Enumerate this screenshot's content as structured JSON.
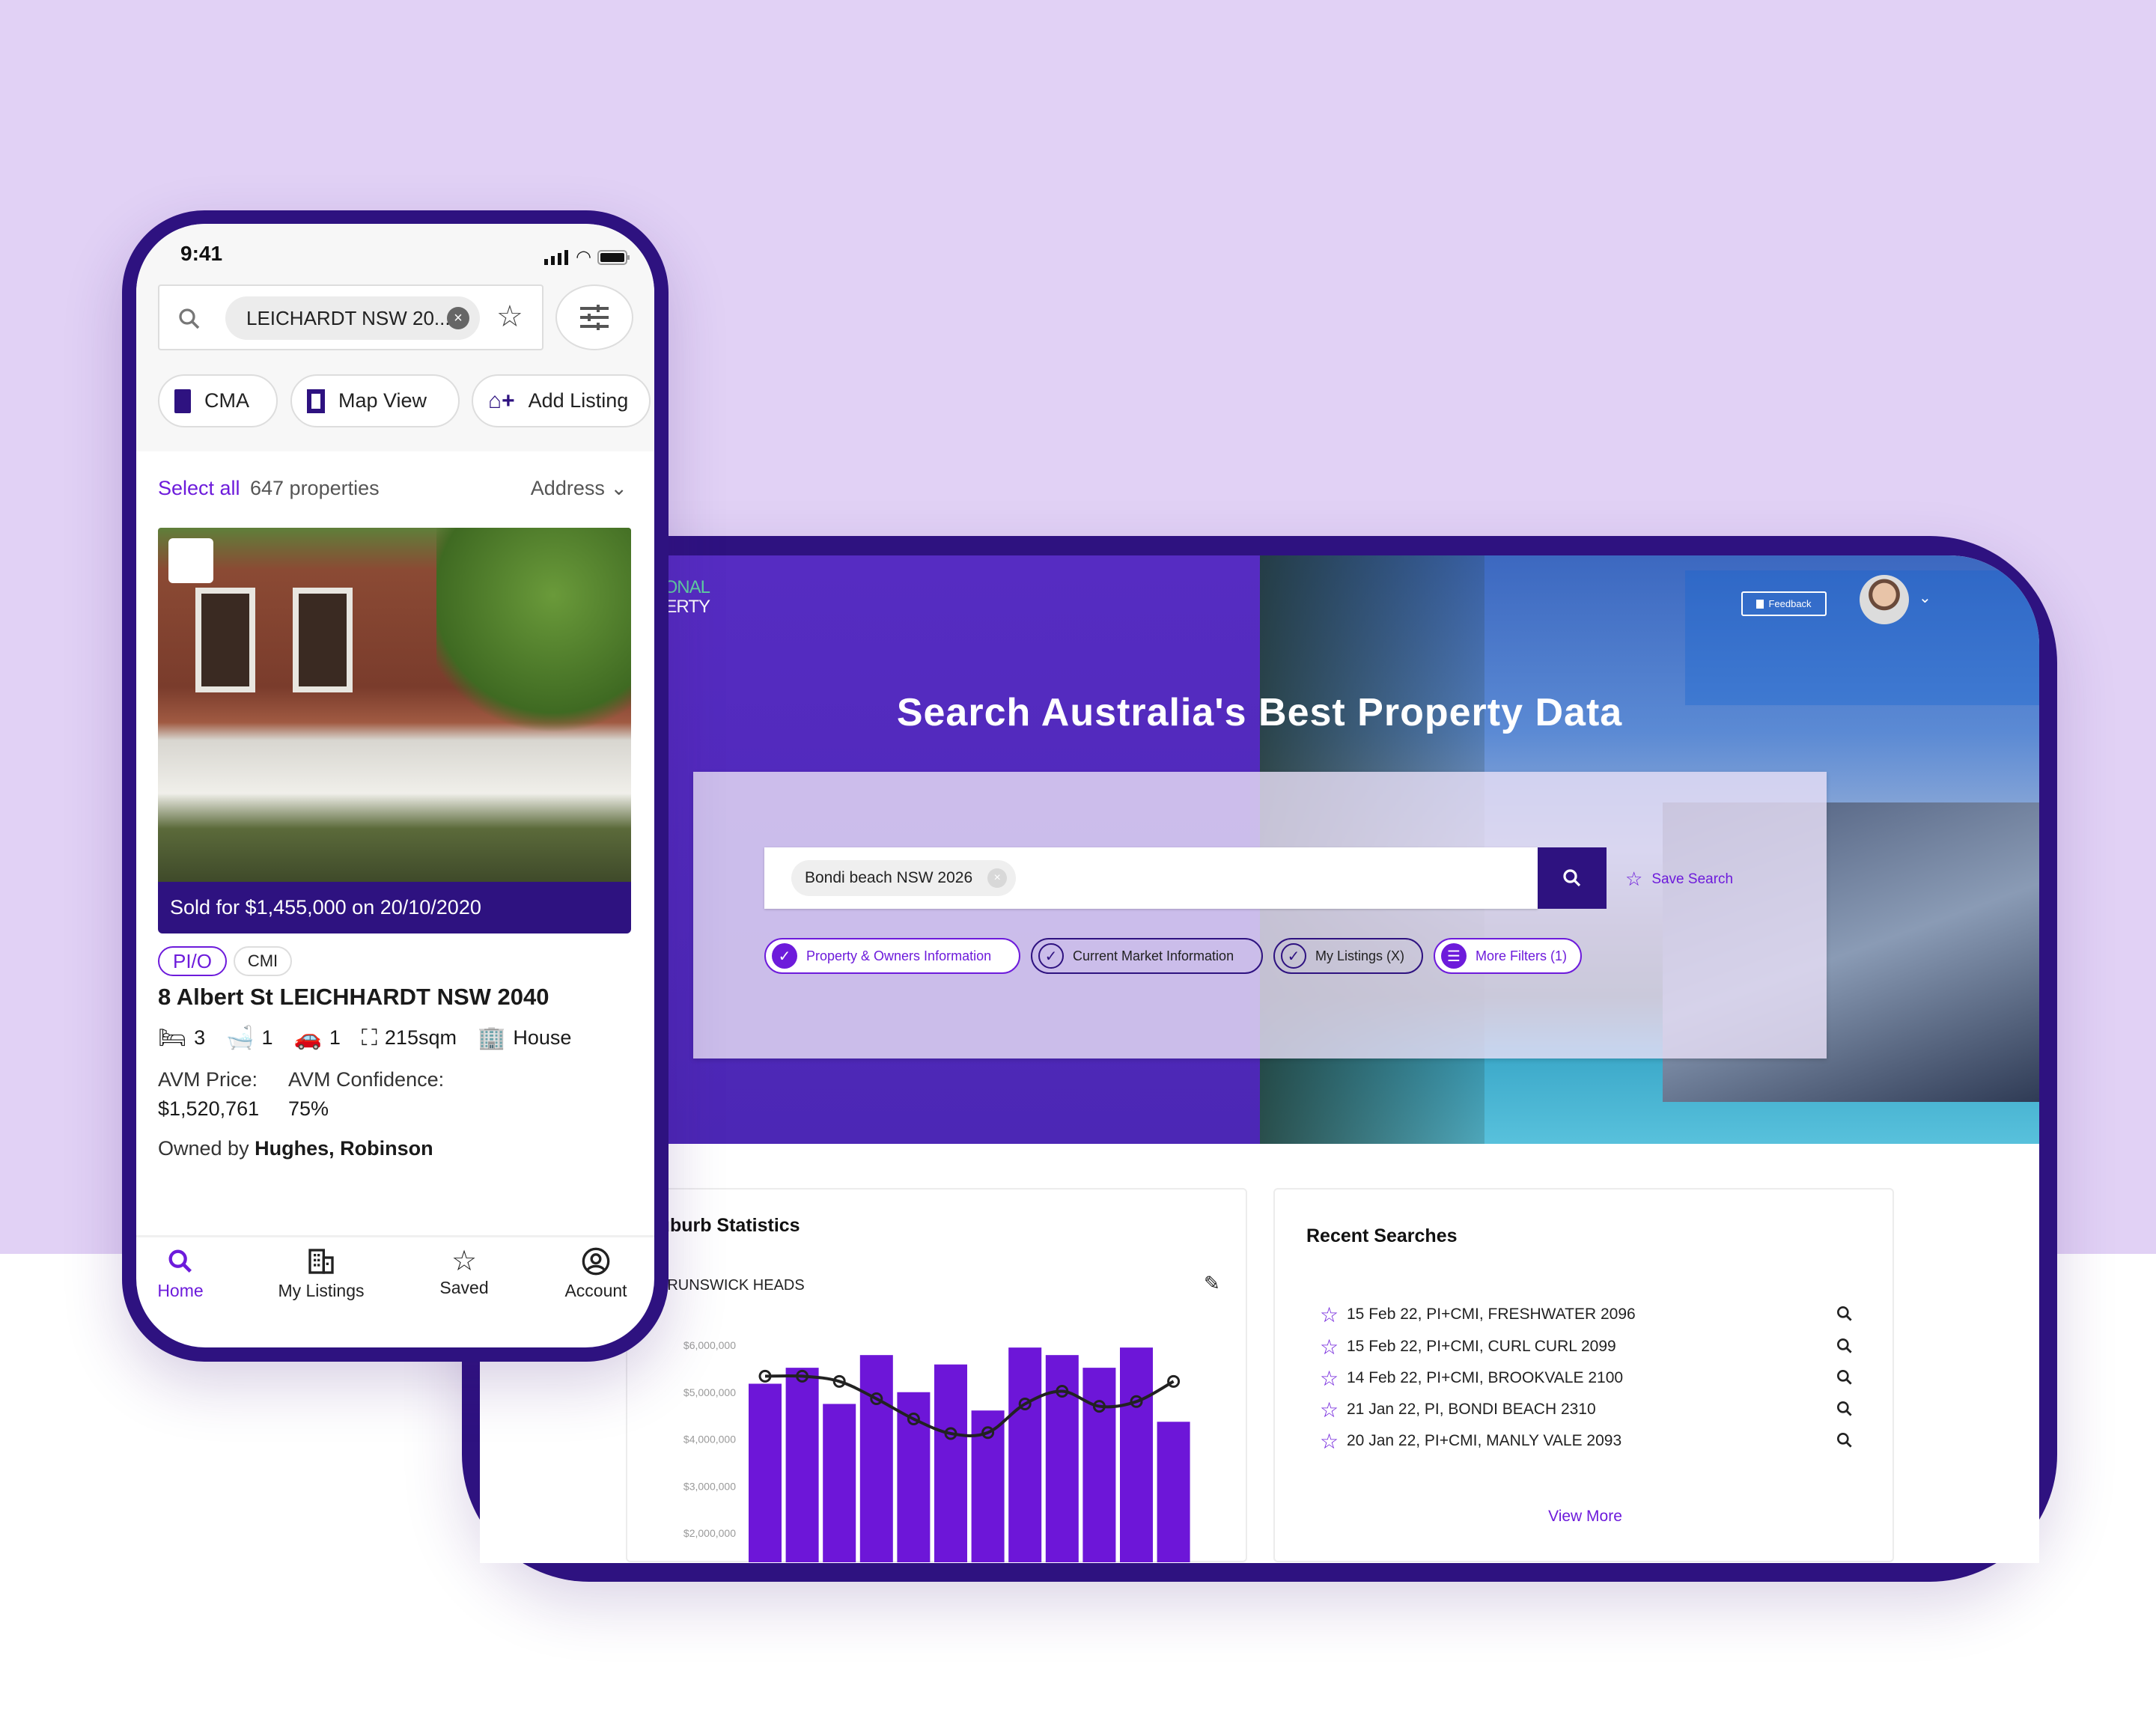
{
  "colors": {
    "accent": "#6d1bdb",
    "dark": "#2e1280",
    "background": "#e1d1f5",
    "bar": "#6d16d8"
  },
  "desktop": {
    "logo_lines": [
      "ONAL",
      "PERTY"
    ],
    "feedback_label": "Feedback",
    "hero_title": "Search Australia's Best Property Data",
    "search": {
      "tag": "Bondi beach NSW 2026",
      "save_label": "Save Search"
    },
    "filters": [
      {
        "label": "Property & Owners Information",
        "checked": true
      },
      {
        "label": "Current Market Information",
        "checked": true
      },
      {
        "label": "My Listings (X)",
        "checked": true
      },
      {
        "label": "More Filters (1)",
        "icon": "sliders-icon"
      }
    ],
    "stats": {
      "title": "Suburb Statistics",
      "suburb": "BRUNSWICK HEADS"
    },
    "recent": {
      "title": "Recent Searches",
      "items": [
        "15 Feb 22, PI+CMI, FRESHWATER 2096",
        "15 Feb 22, PI+CMI, CURL CURL 2099",
        "14 Feb 22, PI+CMI, BROOKVALE 2100",
        "21 Jan 22, PI, BONDI BEACH 2310",
        "20 Jan 22, PI+CMI, MANLY VALE 2093"
      ],
      "view_more": "View More"
    }
  },
  "chart_data": {
    "type": "bar",
    "yticks": [
      "$6,000,000",
      "$5,000,000",
      "$4,000,000",
      "$3,000,000",
      "$2,000,000"
    ],
    "ylim": [
      2000000,
      6000000
    ],
    "series": [
      {
        "type": "bar",
        "values": [
          5180000,
          5520000,
          4750000,
          5790000,
          5000000,
          5590000,
          4610000,
          5950000,
          5790000,
          5520000,
          5950000,
          4370000
        ]
      },
      {
        "type": "line",
        "values": [
          5340000,
          5340000,
          5230000,
          4860000,
          4430000,
          4120000,
          4140000,
          4750000,
          5020000,
          4700000,
          4800000,
          5230000
        ]
      }
    ]
  },
  "phone": {
    "time": "9:41",
    "search_tag": "LEICHARDT NSW 20...",
    "actions": [
      "CMA",
      "Map View",
      "Add Listing"
    ],
    "select_all": "Select all",
    "count": "647 properties",
    "sort": "Address",
    "listing": {
      "sold": "Sold for $1,455,000 on 20/10/2020",
      "chips": [
        "PI/O",
        "CMI"
      ],
      "address": "8 Albert St LEICHHARDT NSW 2040",
      "beds": "3",
      "baths": "1",
      "cars": "1",
      "area": "215sqm",
      "type": "House",
      "avm_price_label": "AVM Price:",
      "avm_price": "$1,520,761",
      "avm_conf_label": "AVM Confidence:",
      "avm_conf": "75%",
      "owned_prefix": "Owned by",
      "owners": "Hughes, Robinson"
    },
    "nav": [
      {
        "label": "Home",
        "active": true
      },
      {
        "label": "My Listings"
      },
      {
        "label": "Saved"
      },
      {
        "label": "Account"
      }
    ]
  }
}
